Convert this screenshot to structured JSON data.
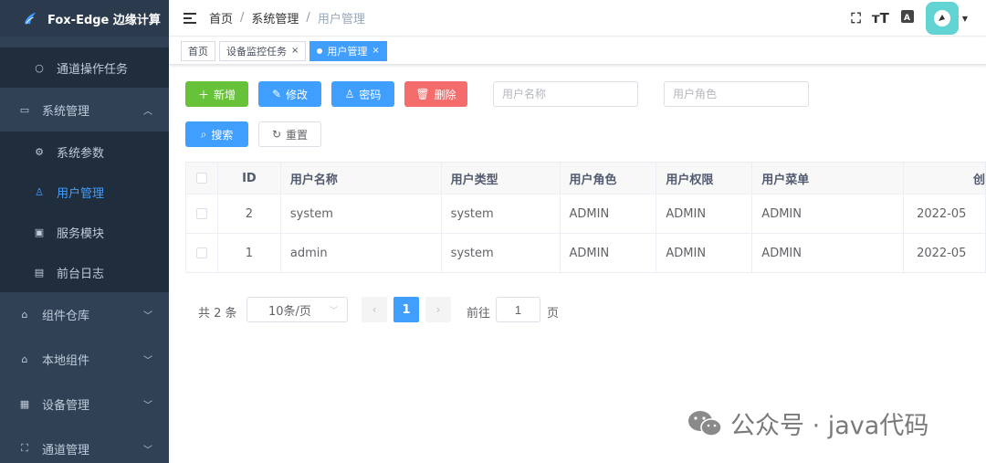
{
  "app": {
    "title": "Fox-Edge 边缘计算"
  },
  "sidebar": {
    "items": [
      {
        "label": "通道操作任务",
        "icon": "circle-icon"
      },
      {
        "label": "系统管理",
        "icon": "monitor-icon"
      },
      {
        "label": "系统参数",
        "icon": "gear-icon"
      },
      {
        "label": "用户管理",
        "icon": "user-icon"
      },
      {
        "label": "服务模块",
        "icon": "module-icon"
      },
      {
        "label": "前台日志",
        "icon": "log-icon"
      },
      {
        "label": "组件仓库",
        "icon": "warehouse-icon"
      },
      {
        "label": "本地组件",
        "icon": "home-icon"
      },
      {
        "label": "设备管理",
        "icon": "grid-icon"
      },
      {
        "label": "通道管理",
        "icon": "channel-icon"
      }
    ]
  },
  "breadcrumb": {
    "items": [
      "首页",
      "系统管理",
      "用户管理"
    ],
    "separator": "/"
  },
  "tags": {
    "items": [
      "首页",
      "设备监控任务",
      "用户管理"
    ]
  },
  "toolbar": {
    "add_label": "新增",
    "edit_label": "修改",
    "password_label": "密码",
    "delete_label": "删除",
    "username_placeholder": "用户名称",
    "role_placeholder": "用户角色",
    "search_label": "搜索",
    "reset_label": "重置"
  },
  "table": {
    "columns": [
      "ID",
      "用户名称",
      "用户类型",
      "用户角色",
      "用户权限",
      "用户菜单",
      "创"
    ],
    "rows": [
      [
        "2",
        "system",
        "system",
        "ADMIN",
        "ADMIN",
        "ADMIN",
        "2022-05"
      ],
      [
        "1",
        "admin",
        "system",
        "ADMIN",
        "ADMIN",
        "ADMIN",
        "2022-05"
      ]
    ]
  },
  "pagination": {
    "total_text": "共 2 条",
    "page_size": "10条/页",
    "current_page": "1",
    "goto_label": "前往",
    "goto_value": "1",
    "page_unit": "页"
  },
  "watermark": {
    "text": "公众号 · java代码"
  },
  "colors": {
    "sidebar_bg": "#304156",
    "primary": "#409eff",
    "success": "#67c23a",
    "danger": "#f56c6c",
    "avatar_bg": "#63d4d4"
  }
}
